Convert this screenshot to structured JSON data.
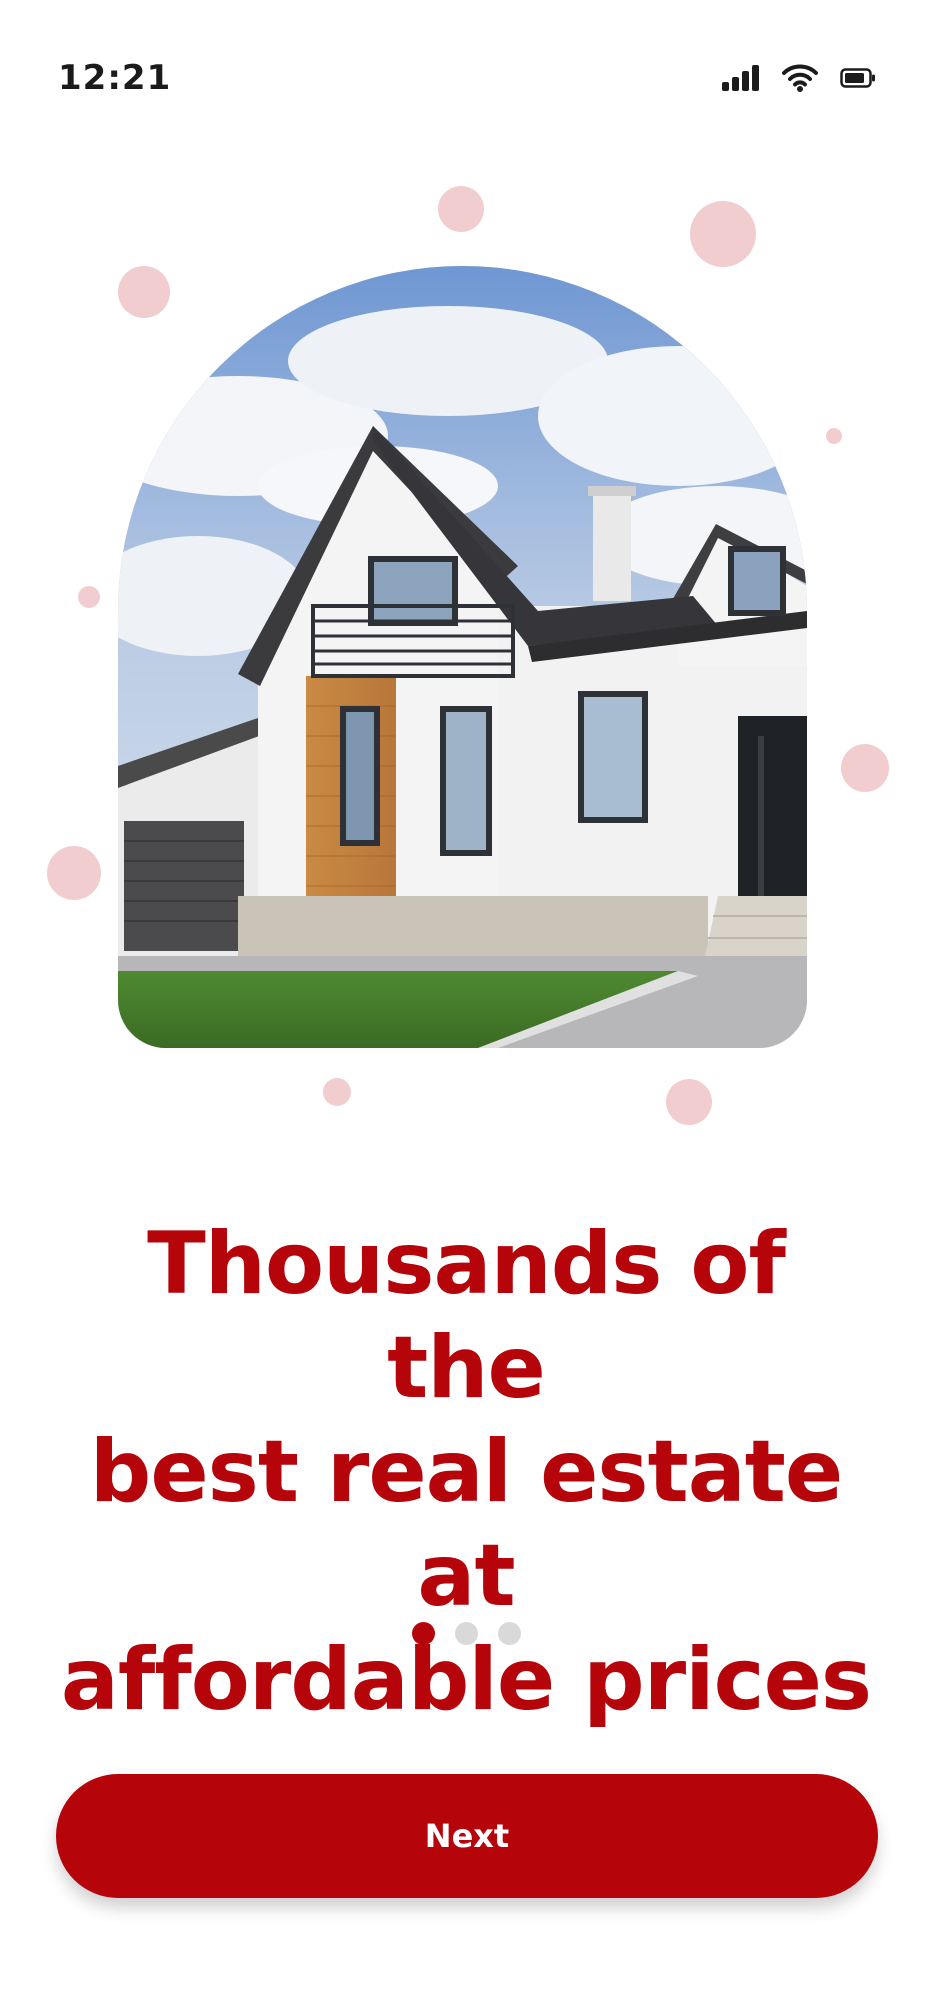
{
  "status_bar": {
    "time": "12:21",
    "icons": [
      "cellular-signal-icon",
      "wifi-icon",
      "battery-icon"
    ]
  },
  "hero": {
    "image_subject": "modern white two-story house with dark roof, wooden panel accent, garage and lawn under cloudy blue sky"
  },
  "onboarding": {
    "headline_line1": "Thousands of the",
    "headline_line2": "best real estate at",
    "headline_line3": "affordable prices",
    "page_count": 3,
    "active_page": 1
  },
  "actions": {
    "next_label": "Next"
  },
  "colors": {
    "accent": "#b5050b",
    "dot_inactive": "#d9d9d9",
    "decor_dot": "#f1cdd0",
    "background": "#ffffff"
  }
}
